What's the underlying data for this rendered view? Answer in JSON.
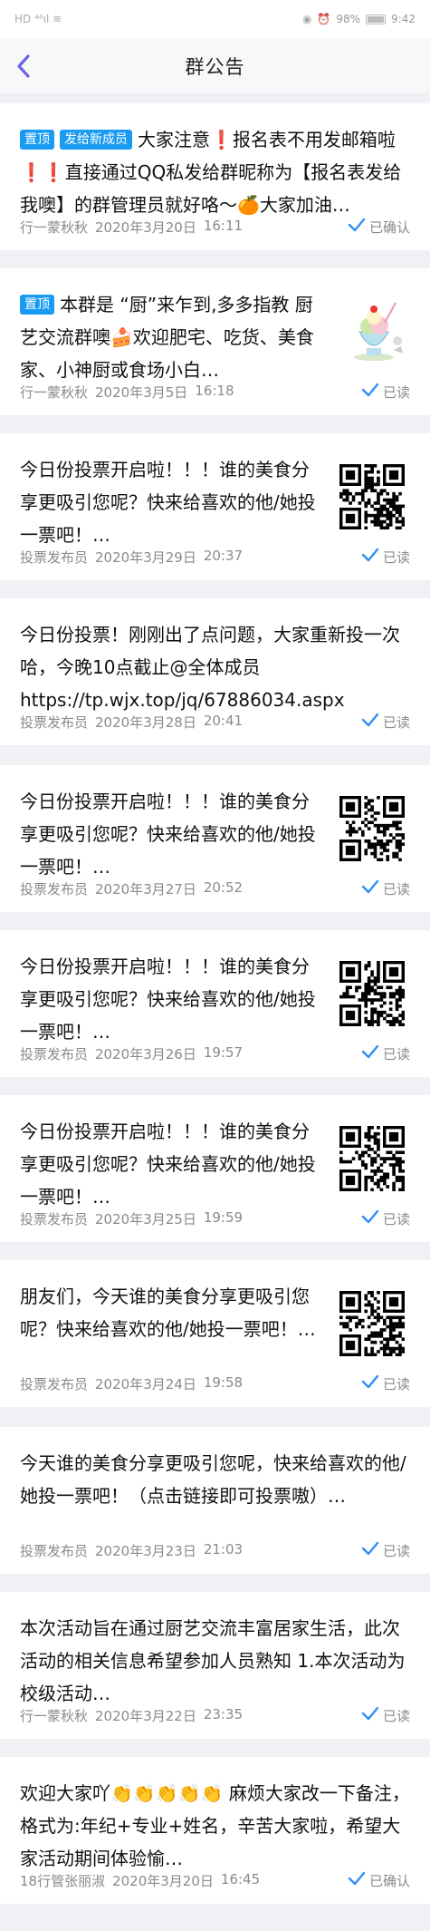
{
  "statusbar": {
    "left_icons": "HD ⁴⁶ıl ≋",
    "battery": "98%",
    "time": "9:42"
  },
  "nav": {
    "title": "群公告",
    "back_icon": "chevron-left-icon"
  },
  "colors": {
    "accent": "#1a9bf2",
    "check": "#2f8ff5",
    "nav_back": "#6c63e8",
    "divider": "#f0f0f5"
  },
  "announcements": [
    {
      "tags": [
        "置顶",
        "发给新成员"
      ],
      "text": "大家注意❗报名表不用发邮箱啦❗❗直接通过QQ私发给群昵称为【报名表发给我噢】的群管理员就好咯～🍊大家加油…",
      "author": "行一蒙秋秋",
      "date": "2020年3月20日",
      "time": "16:11",
      "status": "已确认",
      "thumb": ""
    },
    {
      "tags": [
        "置顶"
      ],
      "text": "本群是 “厨”来乍到,多多指教 厨艺交流群噢🍰欢迎肥宅、吃货、美食家、小神厨或食场小白…",
      "author": "行一蒙秋秋",
      "date": "2020年3月5日",
      "time": "16:18",
      "status": "已读",
      "thumb": "dessert"
    },
    {
      "tags": [],
      "text": "今日份投票开启啦！！！谁的美食分享更吸引您呢？快来给喜欢的他/她投一票吧！…",
      "author": "投票发布员",
      "date": "2020年3月29日",
      "time": "20:37",
      "status": "已读",
      "thumb": "qr"
    },
    {
      "tags": [],
      "text": "今日份投票！刚刚出了点问题，大家重新投一次哈，今晚10点截止@全体成员 https://tp.wjx.top/jq/67886034.aspx",
      "author": "投票发布员",
      "date": "2020年3月28日",
      "time": "20:41",
      "status": "已读",
      "thumb": ""
    },
    {
      "tags": [],
      "text": "今日份投票开启啦！！！谁的美食分享更吸引您呢？快来给喜欢的他/她投一票吧！…",
      "author": "投票发布员",
      "date": "2020年3月27日",
      "time": "20:52",
      "status": "已读",
      "thumb": "qr"
    },
    {
      "tags": [],
      "text": "今日份投票开启啦！！！谁的美食分享更吸引您呢？快来给喜欢的他/她投一票吧！…",
      "author": "投票发布员",
      "date": "2020年3月26日",
      "time": "19:57",
      "status": "已读",
      "thumb": "qr"
    },
    {
      "tags": [],
      "text": "今日份投票开启啦！！！谁的美食分享更吸引您呢？快来给喜欢的他/她投一票吧！…",
      "author": "投票发布员",
      "date": "2020年3月25日",
      "time": "19:59",
      "status": "已读",
      "thumb": "qr"
    },
    {
      "tags": [],
      "text": "朋友们，今天谁的美食分享更吸引您呢？快来给喜欢的他/她投一票吧！…",
      "author": "投票发布员",
      "date": "2020年3月24日",
      "time": "19:58",
      "status": "已读",
      "thumb": "qr"
    },
    {
      "tags": [],
      "text": "今天谁的美食分享更吸引您呢，快来给喜欢的他/她投一票吧！（点击链接即可投票嗷）…",
      "author": "投票发布员",
      "date": "2020年3月23日",
      "time": "21:03",
      "status": "已读",
      "thumb": ""
    },
    {
      "tags": [],
      "text": "本次活动旨在通过厨艺交流丰富居家生活，此次活动的相关信息希望参加人员熟知 1.本次活动为校级活动…",
      "author": "行一蒙秋秋",
      "date": "2020年3月22日",
      "time": "23:35",
      "status": "已读",
      "thumb": ""
    },
    {
      "tags": [],
      "text": "欢迎大家吖👏👏👏👏👏 麻烦大家改一下备注，格式为:年纪+专业+姓名，辛苦大家啦，希望大家活动期间体验愉…",
      "author": "18行管张丽淑",
      "date": "2020年3月20日",
      "time": "16:45",
      "status": "已确认",
      "thumb": ""
    }
  ]
}
